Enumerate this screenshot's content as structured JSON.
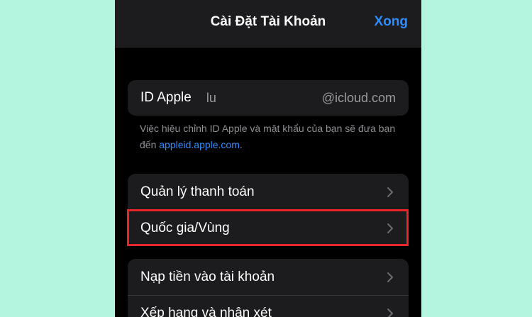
{
  "header": {
    "title": "Cài Đặt Tài Khoản",
    "done_label": "Xong"
  },
  "apple_id": {
    "label": "ID Apple",
    "user": "lu",
    "domain": "@icloud.com",
    "note_text": "Việc hiệu chỉnh ID Apple và mật khẩu của bạn sẽ đưa bạn đến ",
    "note_link": "appleid.apple.com",
    "note_end": "."
  },
  "group1": {
    "items": [
      {
        "label": "Quản lý thanh toán"
      },
      {
        "label": "Quốc gia/Vùng"
      }
    ]
  },
  "group2": {
    "items": [
      {
        "label": "Nạp tiền vào tài khoản"
      },
      {
        "label": "Xếp hạng và nhận xét"
      }
    ]
  },
  "colors": {
    "background": "#b3f5df",
    "accent": "#2f8cff",
    "highlight": "#e8252b",
    "cell": "#1c1c1e"
  },
  "icons": {
    "row_chevron": "chevron-right-icon"
  }
}
